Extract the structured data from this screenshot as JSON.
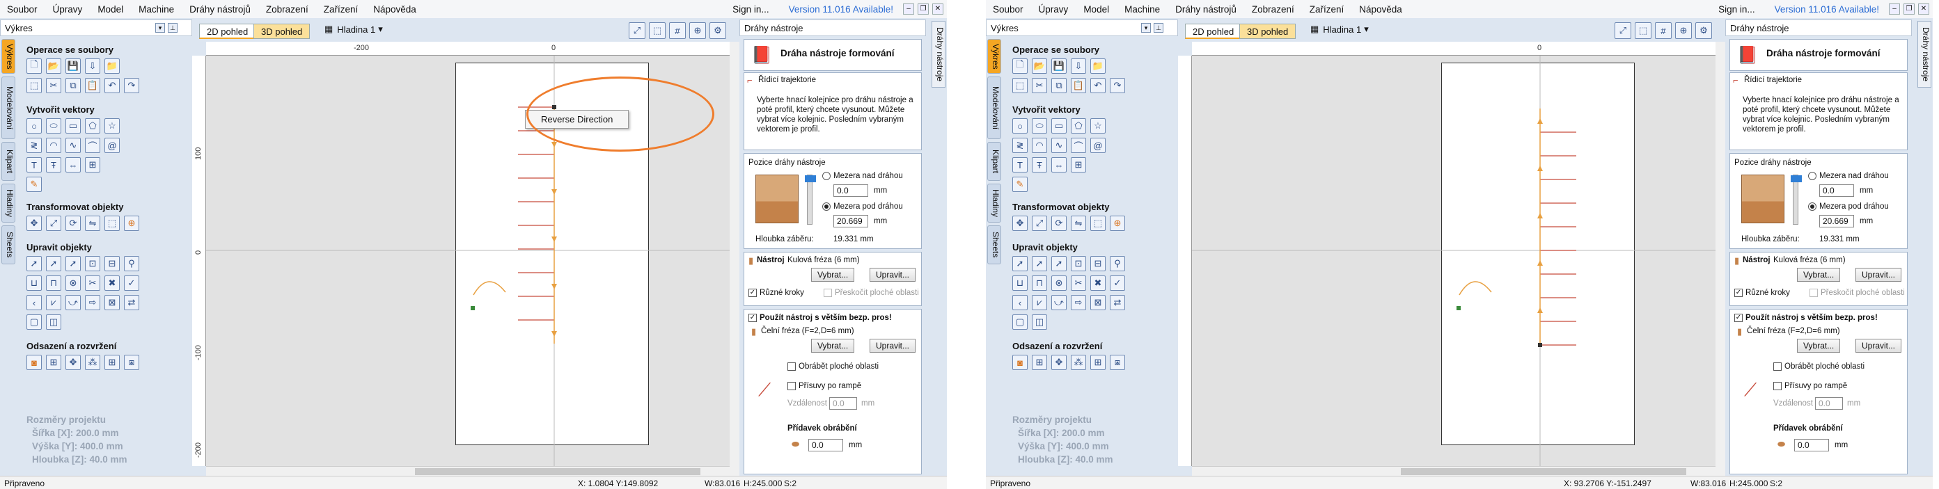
{
  "menu": [
    "Soubor",
    "Úpravy",
    "Model",
    "Machine",
    "Dráhy nástrojů",
    "Zobrazení",
    "Zařízení",
    "Nápověda"
  ],
  "sign_in": "Sign in...",
  "version": "Version 11.016 Available!",
  "left_header": "Výkres",
  "side_tabs": [
    "Výkres",
    "Modelování",
    "Klipart",
    "Hladiny",
    "Sheets"
  ],
  "sections": {
    "file_ops": "Operace se soubory",
    "create_vectors": "Vytvořit vektory",
    "transform": "Transformovat objekty",
    "edit": "Upravit objekty",
    "offset": "Odsazení a rozvržení"
  },
  "project": {
    "title": "Rozměry projektu",
    "width": "Šířka   [X]: 200.0 mm",
    "height": "Výška   [Y]: 400.0 mm",
    "depth": "Hloubka [Z]: 40.0 mm"
  },
  "view_tabs": [
    "2D pohled",
    "3D pohled"
  ],
  "layer": "Hladina 1",
  "ruler": {
    "h": [
      "-200",
      "0"
    ],
    "v": [
      "100",
      "0",
      "-100",
      "-200"
    ]
  },
  "context_menu": "Reverse Direction",
  "right": {
    "header": "Dráhy nástroje",
    "title": "Dráha nástroje formování",
    "rail_title": "Řídicí trajektorie",
    "rail_desc": "Vyberte hnací kolejnice pro dráhu nástroje a poté profil, který chcete vysunout. Můžete vybrat více kolejnic. Posledním vybraným vektorem je profil.",
    "position_title": "Pozice dráhy nástroje",
    "above": "Mezera nad dráhou",
    "above_val": "0.0",
    "below": "Mezera pod dráhou",
    "below_val": "20.669",
    "unit": "mm",
    "depth_label": "Hloubka záběru:",
    "depth_val": "19.331 mm",
    "tool_label": "Nástroj",
    "tool_name": "Kulová fréza (6 mm)",
    "select": "Vybrat...",
    "edit": "Upravit...",
    "steps": "Různé kroky",
    "skip_flat": "Přeskočit ploché oblasti",
    "larger_tool": "Použít nástroj s větším bezp. pros!",
    "face_mill": "Čelní fréza (F=2,D=6 mm)",
    "machine_flat": "Obrábět ploché oblasti",
    "ramp": "Přísuvy po rampě",
    "distance": "Vzdálenost",
    "distance_val": "0.0",
    "allowance": "Přídavek obrábění",
    "allowance_val": "0.0",
    "side_tab": "Dráhy nástroje"
  },
  "status": {
    "ready": "Připraveno",
    "coords_left": "X: 1.0804 Y:149.8092",
    "coords_right": "X: 93.2706 Y:-151.2497",
    "w": "W:83.016",
    "h": "H:245.000",
    "s": "S:2"
  },
  "colors": {
    "accent": "#f5a623",
    "annotation": "#ef7d2d",
    "toolpath": "#c74a3a",
    "vector": "#e8a040",
    "version": "#2b6cd4"
  }
}
